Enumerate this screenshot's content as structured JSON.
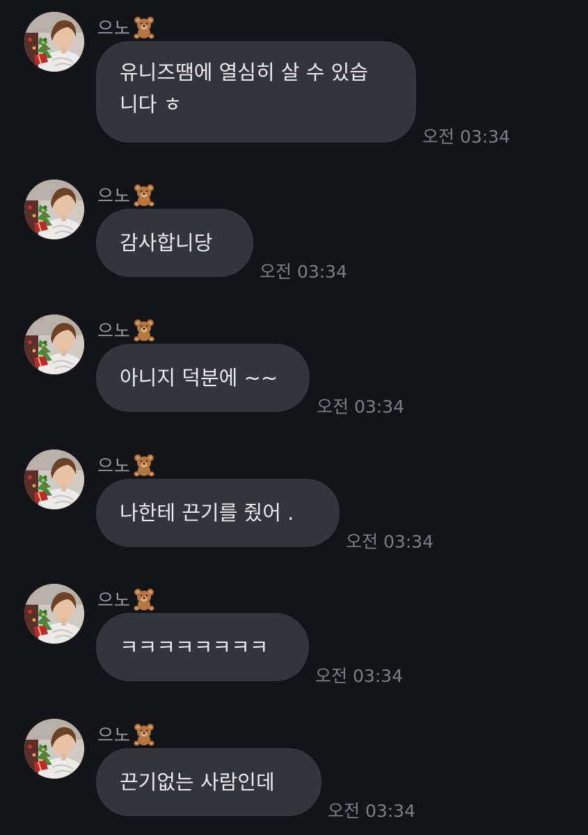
{
  "sender": {
    "name": "으노",
    "emoji": "🧸"
  },
  "messages": [
    {
      "lines": [
        "유니즈땜에 열심히 살 수 있습",
        "니다 ㅎ"
      ],
      "time": "오전 03:34"
    },
    {
      "lines": [
        "감사합니당"
      ],
      "time": "오전 03:34"
    },
    {
      "lines": [
        "아니지 덕분에 ~~"
      ],
      "time": "오전 03:34"
    },
    {
      "lines": [
        "나한테 끈기를 줬어 ."
      ],
      "time": "오전 03:34"
    },
    {
      "lines": [
        "ㅋㅋㅋㅋㅋㅋㅋㅋ"
      ],
      "time": "오전 03:34"
    },
    {
      "lines": [
        "끈기없는 사람인데"
      ],
      "time": "오전 03:34"
    }
  ]
}
